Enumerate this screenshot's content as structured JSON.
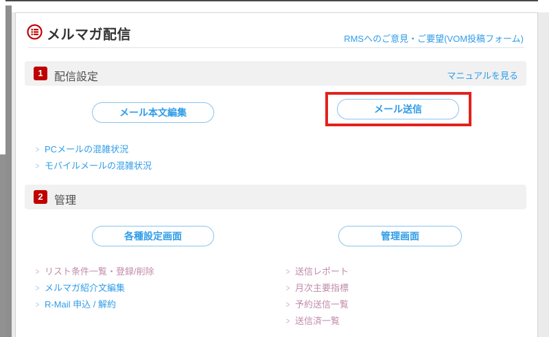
{
  "header": {
    "title": "メルマガ配信",
    "feedback_link": "RMSへのご意見・ご要望(VOM投稿フォーム)"
  },
  "section1": {
    "number": "1",
    "title": "配信設定",
    "manual_link": "マニュアルを見る",
    "button_left": "メール本文編集",
    "button_right": "メール送信",
    "links": [
      {
        "label": "PCメールの混雑状況"
      },
      {
        "label": "モバイルメールの混雑状況"
      }
    ]
  },
  "section2": {
    "number": "2",
    "title": "管理",
    "button_left": "各種設定画面",
    "button_right": "管理画面",
    "links_left": [
      {
        "label": "リスト条件一覧・登録/削除",
        "visited": true
      },
      {
        "label": "メルマガ紹介文編集",
        "visited": false
      },
      {
        "label": "R-Mail 申込 / 解約",
        "visited": false
      }
    ],
    "links_right": [
      {
        "label": "送信レポート",
        "visited": true
      },
      {
        "label": "月次主要指標",
        "visited": true
      },
      {
        "label": "予約送信一覧",
        "visited": true
      },
      {
        "label": "送信済一覧",
        "visited": true
      }
    ]
  },
  "colors": {
    "brand_red": "#bf0000",
    "link_blue": "#2f9ce8",
    "visited_link": "#c08ba9",
    "highlight_red": "#e3211c",
    "section_bar_bg": "#f1f1f1"
  }
}
